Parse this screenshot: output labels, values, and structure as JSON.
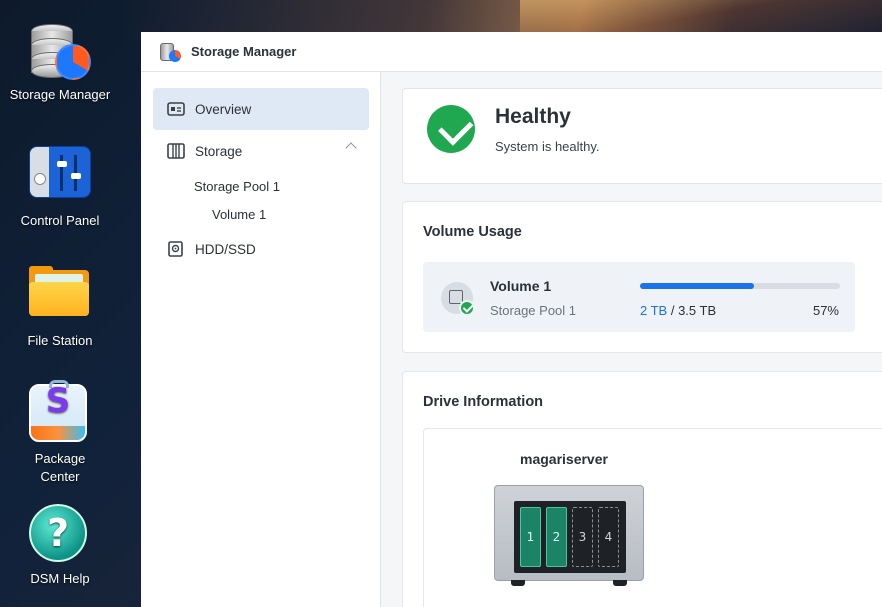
{
  "desktop": {
    "icons": [
      {
        "label": "Storage Manager"
      },
      {
        "label": "Control Panel"
      },
      {
        "label": "File Station"
      },
      {
        "label": "Package Center"
      },
      {
        "label": "DSM Help"
      }
    ]
  },
  "window": {
    "title": "Storage Manager"
  },
  "sidebar": {
    "items": [
      {
        "label": "Overview",
        "active": true
      },
      {
        "label": "Storage"
      },
      {
        "label": "HDD/SSD"
      }
    ],
    "storage_children": {
      "pool": "Storage Pool 1",
      "volume": "Volume 1"
    }
  },
  "health": {
    "title": "Healthy",
    "subtitle": "System is healthy.",
    "status_color": "#1fa84f"
  },
  "volume_usage": {
    "heading": "Volume Usage",
    "volume_name": "Volume 1",
    "pool_name": "Storage Pool 1",
    "used": "2 TB",
    "separator": " / ",
    "total": "3.5 TB",
    "percent_label": "57%",
    "percent": 57,
    "bar_color": "#1a73e8"
  },
  "drive_info": {
    "heading": "Drive Information",
    "server_name": "magariserver",
    "bays": [
      {
        "label": "1",
        "state": "installed"
      },
      {
        "label": "2",
        "state": "installed"
      },
      {
        "label": "3",
        "state": "empty"
      },
      {
        "label": "4",
        "state": "empty"
      }
    ]
  }
}
